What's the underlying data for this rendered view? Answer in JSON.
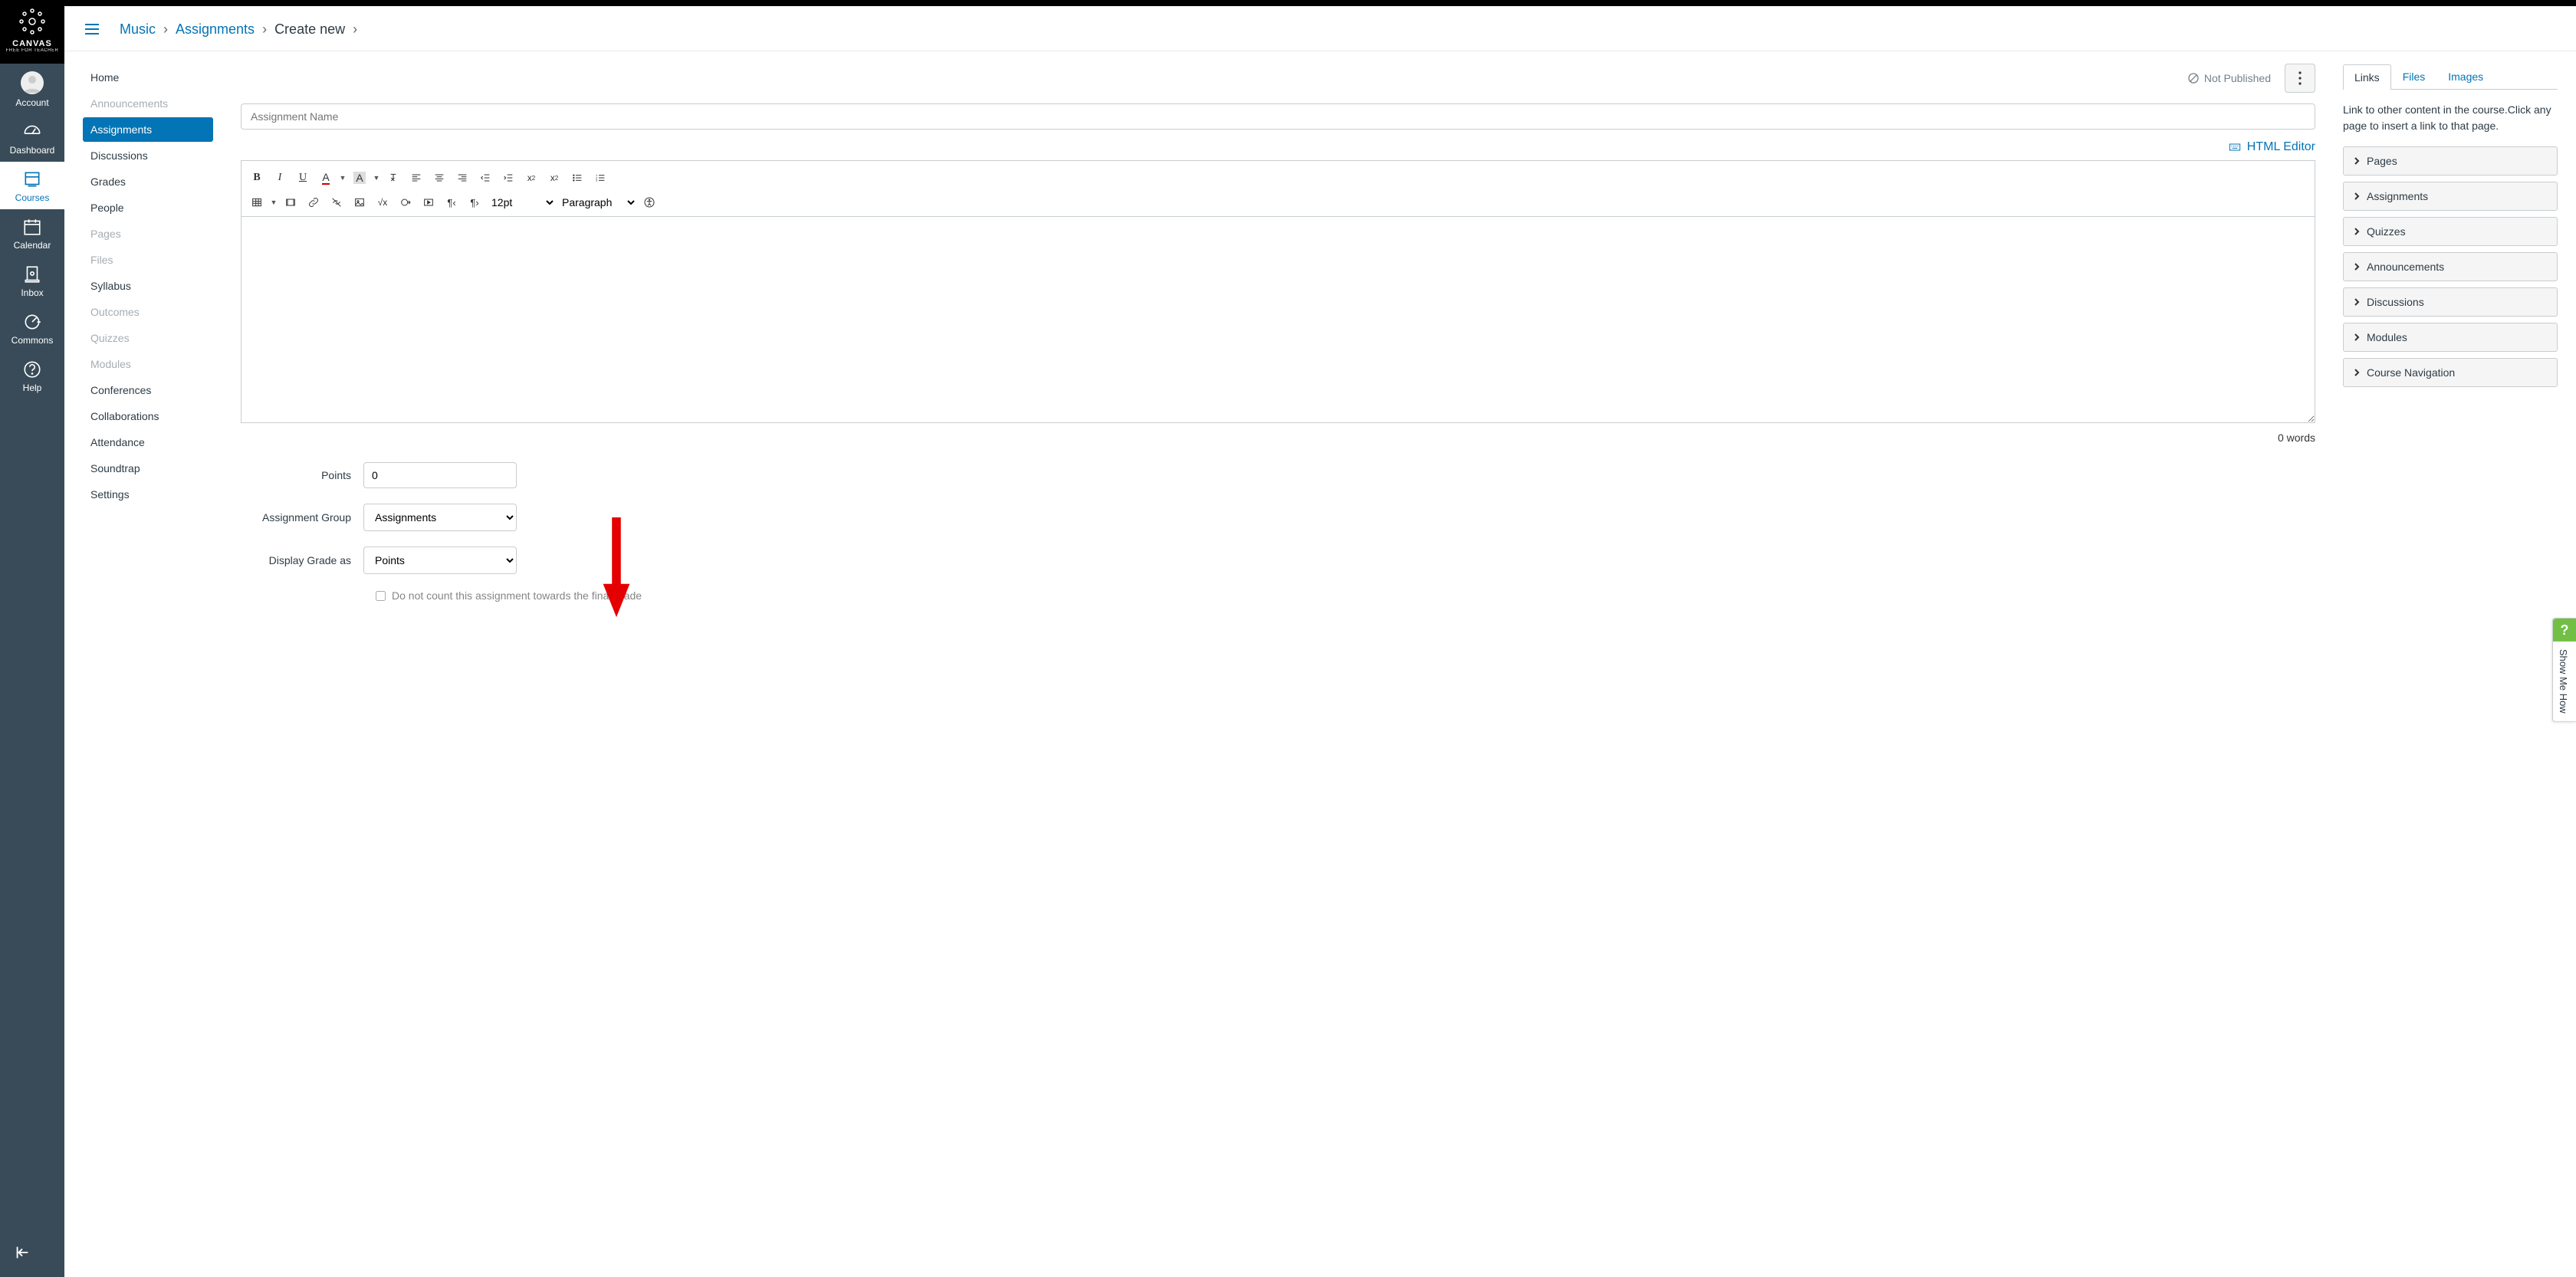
{
  "brand": {
    "name": "CANVAS",
    "sub": "FREE FOR TEACHER"
  },
  "global_nav": [
    {
      "key": "account",
      "label": "Account"
    },
    {
      "key": "dashboard",
      "label": "Dashboard"
    },
    {
      "key": "courses",
      "label": "Courses",
      "active": true
    },
    {
      "key": "calendar",
      "label": "Calendar"
    },
    {
      "key": "inbox",
      "label": "Inbox"
    },
    {
      "key": "commons",
      "label": "Commons"
    },
    {
      "key": "help",
      "label": "Help"
    }
  ],
  "breadcrumbs": {
    "course": "Music",
    "section": "Assignments",
    "current": "Create new"
  },
  "course_nav": [
    {
      "label": "Home"
    },
    {
      "label": "Announcements",
      "disabled": true
    },
    {
      "label": "Assignments",
      "active": true
    },
    {
      "label": "Discussions"
    },
    {
      "label": "Grades"
    },
    {
      "label": "People"
    },
    {
      "label": "Pages",
      "disabled": true
    },
    {
      "label": "Files",
      "disabled": true
    },
    {
      "label": "Syllabus"
    },
    {
      "label": "Outcomes",
      "disabled": true
    },
    {
      "label": "Quizzes",
      "disabled": true
    },
    {
      "label": "Modules",
      "disabled": true
    },
    {
      "label": "Conferences"
    },
    {
      "label": "Collaborations"
    },
    {
      "label": "Attendance"
    },
    {
      "label": "Soundtrap"
    },
    {
      "label": "Settings"
    }
  ],
  "header": {
    "not_published": "Not Published"
  },
  "name_input": {
    "placeholder": "Assignment Name",
    "value": ""
  },
  "html_editor": "HTML Editor",
  "font_size": "12pt",
  "block_format": "Paragraph",
  "word_count": "0 words",
  "form": {
    "points_label": "Points",
    "points_value": "0",
    "group_label": "Assignment Group",
    "group_value": "Assignments",
    "display_label": "Display Grade as",
    "display_value": "Points",
    "checkbox": "Do not count this assignment towards the final grade"
  },
  "right": {
    "tabs": {
      "links": "Links",
      "files": "Files",
      "images": "Images"
    },
    "help": "Link to other content in the course.Click any page to insert a link to that page.",
    "items": [
      "Pages",
      "Assignments",
      "Quizzes",
      "Announcements",
      "Discussions",
      "Modules",
      "Course Navigation"
    ]
  },
  "show_me": "Show Me How"
}
